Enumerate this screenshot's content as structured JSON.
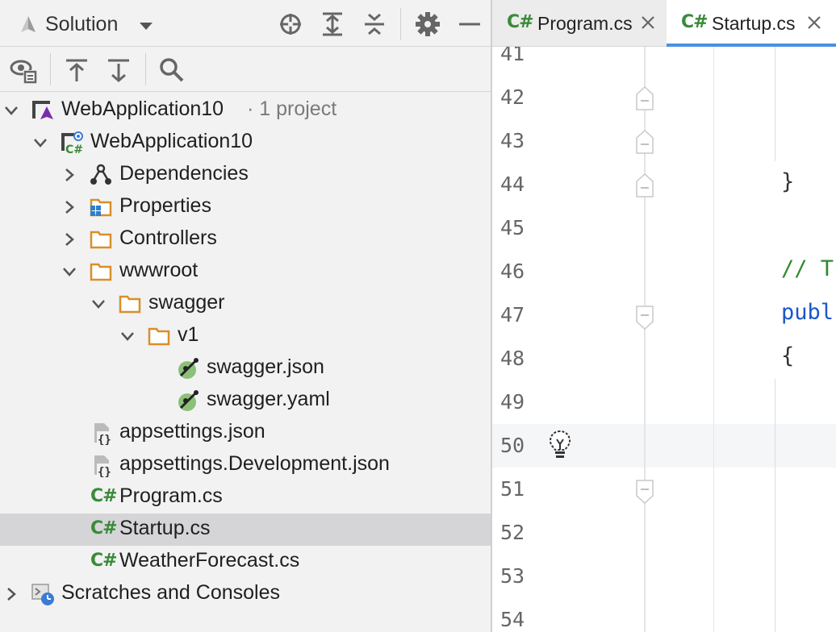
{
  "solution_panel": {
    "title": "Solution",
    "icons": [
      "solution-icon",
      "locate-icon",
      "expand-all-icon",
      "collapse-all-icon",
      "gear-icon",
      "minimize-icon"
    ],
    "toolbar_icons": [
      "show-files-icon",
      "move-up-icon",
      "move-down-icon",
      "search-icon"
    ]
  },
  "tree": {
    "solution": {
      "name": "WebApplication10",
      "suffix": "· 1 project"
    },
    "project": {
      "name": "WebApplication10"
    },
    "items": [
      {
        "label": "Dependencies"
      },
      {
        "label": "Properties"
      },
      {
        "label": "Controllers"
      },
      {
        "label": "wwwroot"
      },
      {
        "label": "swagger"
      },
      {
        "label": "v1"
      },
      {
        "label": "swagger.json"
      },
      {
        "label": "swagger.yaml"
      },
      {
        "label": "appsettings.json"
      },
      {
        "label": "appsettings.Development.json"
      },
      {
        "label": "Program.cs"
      },
      {
        "label": "Startup.cs"
      },
      {
        "label": "WeatherForecast.cs"
      },
      {
        "label": "Scratches and Consoles"
      }
    ],
    "csharp_badge": "C#",
    "selected": "Startup.cs"
  },
  "tabs": [
    {
      "badge": "C#",
      "label": "Program.cs"
    },
    {
      "badge": "C#",
      "label": "Startup.cs"
    }
  ],
  "editor": {
    "line_numbers": [
      "41",
      "42",
      "43",
      "44",
      "45",
      "46",
      "47",
      "48",
      "49",
      "50",
      "51",
      "52",
      "53",
      "54"
    ],
    "code": {
      "close_brace": "}",
      "comment": "// T",
      "keyword": "publ",
      "open_brace": "{"
    },
    "current_line": "50"
  },
  "colors": {
    "accent": "#4a90e2",
    "csharp": "#3a8a3a",
    "comment": "#2e8b2e",
    "keyword": "#1a56c8",
    "folder": "#d88f2a"
  }
}
